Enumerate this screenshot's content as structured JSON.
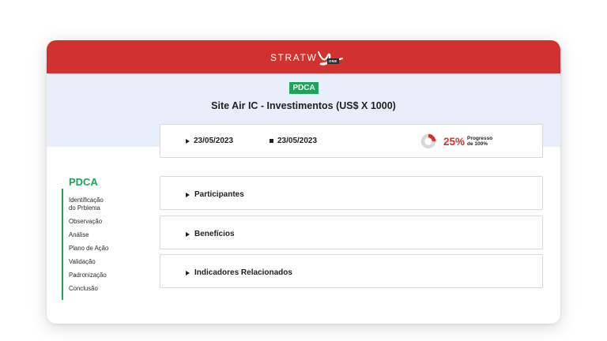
{
  "header": {
    "logo_text": "STRATW",
    "logo_badge": "ONE",
    "brand_color": "#d1312f"
  },
  "page": {
    "badge": "PDCA",
    "badge_color": "#1fa35a",
    "title": "Site Air IC - Investimentos (US$ X 1000)"
  },
  "dates": {
    "start": "23/05/2023",
    "end": "23/05/2023",
    "start_icon": "play-triangle-icon",
    "end_icon": "stop-square-icon"
  },
  "progress": {
    "percent_label": "25%",
    "value": 0.25,
    "caption_line1": "Progresso",
    "caption_line2": "de 100%"
  },
  "sections": [
    {
      "label": "Participantes"
    },
    {
      "label": "Benefícios"
    },
    {
      "label": "Indicadores Relacionados"
    }
  ],
  "sidebar": {
    "title": "PDCA",
    "items": [
      {
        "label": "Identificação\ndo Prblema"
      },
      {
        "label": "Observação"
      },
      {
        "label": "Análise"
      },
      {
        "label": "Plano de Ação"
      },
      {
        "label": "Validação"
      },
      {
        "label": "Padronização"
      },
      {
        "label": "Conclusão"
      }
    ]
  }
}
